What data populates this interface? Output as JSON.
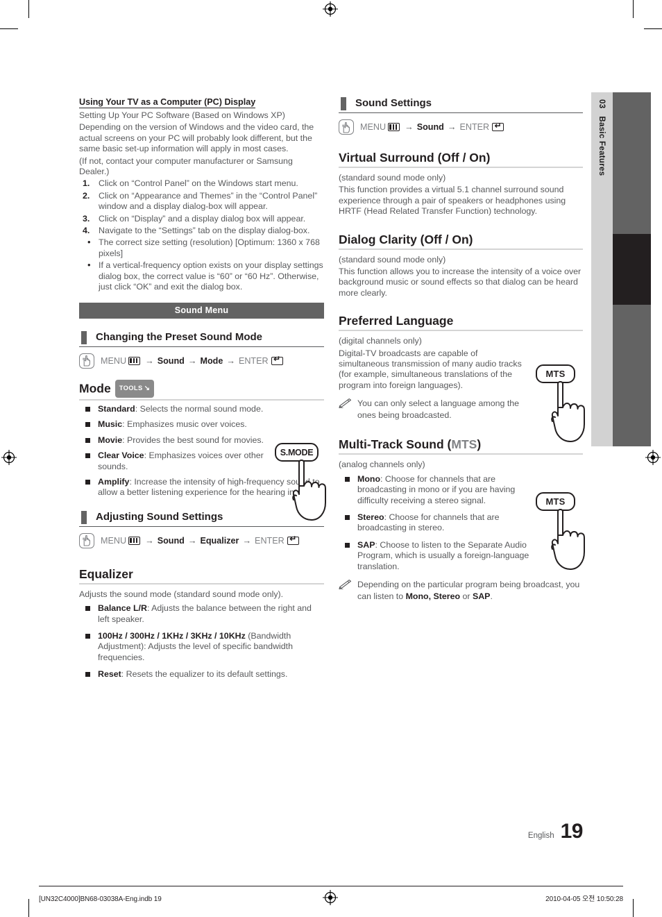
{
  "page": {
    "number": "19",
    "language_label": "English",
    "chapter_number": "03",
    "chapter_title": "Basic Features"
  },
  "left_column": {
    "pc_display": {
      "heading": "Using Your TV as a Computer (PC) Display",
      "subheading": "Setting Up Your PC Software (Based on Windows XP)",
      "paragraph1": "Depending on the version of Windows and the video card, the actual screens on your PC will probably look different, but the same basic set-up information will apply in most cases.",
      "paragraph2": "(If not, contact your computer manufacturer or Samsung Dealer.)",
      "steps": [
        "Click on “Control Panel” on the Windows start menu.",
        "Click on “Appearance and Themes” in the “Control Panel” window and a display dialog-box will appear.",
        "Click on “Display” and a display dialog box will appear.",
        "Navigate to the “Settings” tab on the display dialog-box."
      ],
      "bullets": [
        "The correct size setting (resolution) [Optimum: 1360 x 768 pixels]",
        "If a vertical-frequency option exists on your display settings dialog box, the correct value is “60” or “60 Hz”. Otherwise, just click “OK” and exit the dialog box."
      ]
    },
    "sound_menu_band": "Sound Menu",
    "changing_preset": {
      "subhead": "Changing the Preset Sound Mode",
      "path": {
        "menu": "MENU",
        "items": [
          "Sound",
          "Mode"
        ],
        "enter": "ENTER"
      }
    },
    "mode": {
      "title": "Mode",
      "tools_badge": "TOOLS",
      "items": [
        {
          "term": "Standard",
          "desc": ": Selects the normal sound mode."
        },
        {
          "term": "Music",
          "desc": ": Emphasizes music over voices."
        },
        {
          "term": "Movie",
          "desc": ": Provides the best sound for movies."
        },
        {
          "term": "Clear Voice",
          "desc": ": Emphasizes voices over other sounds."
        },
        {
          "term": "Amplify",
          "desc": ": Increase the intensity of high-frequency sound to allow a better listening experience for the hearing impaired."
        }
      ],
      "remote_button": "S.MODE"
    },
    "adjusting": {
      "subhead": "Adjusting Sound Settings",
      "path": {
        "menu": "MENU",
        "items": [
          "Sound",
          "Equalizer"
        ],
        "enter": "ENTER"
      }
    },
    "equalizer": {
      "title": "Equalizer",
      "intro": "Adjusts the sound mode (standard sound mode only).",
      "items": [
        {
          "term": "Balance L/R",
          "desc": ": Adjusts the balance between the right and left speaker."
        },
        {
          "term": "100Hz / 300Hz / 1KHz / 3KHz / 10KHz",
          "desc": " (Bandwidth Adjustment): Adjusts the level of specific bandwidth frequencies."
        },
        {
          "term": "Reset",
          "desc": ": Resets the equalizer to its default settings."
        }
      ]
    }
  },
  "right_column": {
    "sound_settings": {
      "subhead": "Sound Settings",
      "path": {
        "menu": "MENU",
        "items": [
          "Sound"
        ],
        "enter": "ENTER"
      }
    },
    "virtual_surround": {
      "title": "Virtual Surround (Off / On)",
      "note_mode": "(standard sound mode only)",
      "body": "This function provides a virtual 5.1 channel surround sound experience through a pair of speakers or headphones using HRTF (Head Related Transfer Function) technology."
    },
    "dialog_clarity": {
      "title": "Dialog Clarity (Off / On)",
      "note_mode": "(standard sound mode only)",
      "body": "This function allows you to increase the intensity of a voice over background music or sound effects so that dialog can be heard more clearly."
    },
    "preferred_language": {
      "title": "Preferred Language",
      "note_mode": "(digital channels only)",
      "body": "Digital-TV broadcasts are capable of simultaneous transmission of many audio tracks (for example, simultaneous translations of the program into foreign languages).",
      "note": "You can only select a language among the ones being broadcasted.",
      "remote_button": "MTS"
    },
    "multi_track_sound": {
      "title_prefix": "Multi-Track Sound (",
      "title_accent": "MTS",
      "title_suffix": ")",
      "note_mode": "(analog channels only)",
      "items": [
        {
          "term": "Mono",
          "desc": ": Choose for channels that are broadcasting in mono or if you are having difficulty receiving a stereo signal."
        },
        {
          "term": "Stereo",
          "desc": ": Choose for channels that are broadcasting in stereo."
        },
        {
          "term": "SAP",
          "desc": ": Choose to listen to the Separate Audio Program, which is usually a foreign-language translation."
        }
      ],
      "note_pre": "Depending on the particular program being broadcast, you can listen to ",
      "note_bold1": "Mono, Stereo",
      "note_mid": " or ",
      "note_bold2": "SAP",
      "note_end": ".",
      "remote_button": "MTS"
    }
  },
  "footer": {
    "file": "[UN32C4000]BN68-03038A-Eng.indb   19",
    "date": "2010-04-05   오전 10:50:28"
  },
  "colors": {
    "band": "#636363",
    "sidebar_light": "#d2d2d2",
    "sidebar_dark": "#636363",
    "sidebar_black": "#231f20",
    "body_text": "#58595b",
    "heading": "#231f20",
    "accent_gray": "#808285"
  }
}
